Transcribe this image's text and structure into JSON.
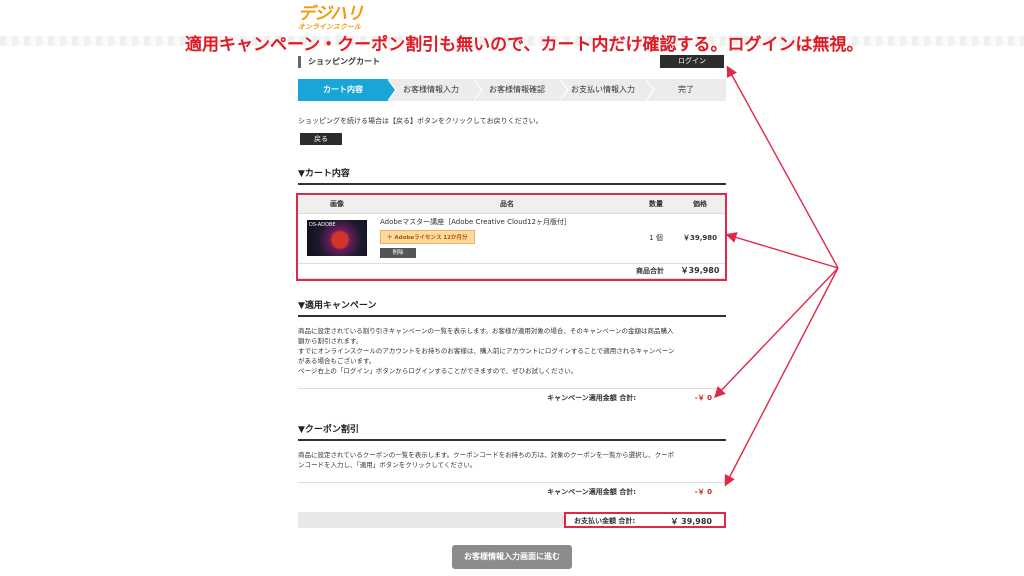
{
  "logo": {
    "line1": "デジハリ",
    "line2": "オンラインスクール"
  },
  "annotation": "適用キャンペーン・クーポン割引も無いので、カート内だけ確認する。ログインは無視。",
  "header": {
    "title": "ショッピングカート",
    "login_label": "ログイン"
  },
  "steps": [
    "カート内容",
    "お客様情報入力",
    "お客様情報確認",
    "お支払い情報入力",
    "完了"
  ],
  "intro": {
    "text": "ショッピングを続ける場合は【戻る】ボタンをクリックしてお戻りください。",
    "back_label": "戻る"
  },
  "cart": {
    "section_title": "▼カート内容",
    "headers": {
      "image": "画像",
      "name": "品名",
      "qty": "数量",
      "price": "価格"
    },
    "item": {
      "thumb_label": "DS-ADOBE",
      "name": "Adobeマスター講座［Adobe Creative Cloud12ヶ月版付］",
      "badge": "＋ Adobeライセンス 12か月分",
      "delete_label": "削除",
      "qty": "1 個",
      "price": "￥39,980"
    },
    "subtotal_label": "商品合計",
    "subtotal_value": "￥39,980"
  },
  "campaign": {
    "section_title": "▼適用キャンペーン",
    "description_lines": [
      "商品に設定されている割り引きキャンペーンの一覧を表示します。お客様が適用対象の場合、そのキャンペーンの金額は商品購入",
      "額から割引されます。",
      "すでにオンラインスクールのアカウントをお持ちのお客様は、購入前にアカウントにログインすることで適用されるキャンペーン",
      "がある場合もございます。",
      "ページ右上の「ログイン」ボタンからログインすることができますので、ぜひお試しください。"
    ],
    "sum_label": "キャンペーン適用金額 合計:",
    "sum_value": "-￥ 0"
  },
  "coupon": {
    "section_title": "▼クーポン割引",
    "description_lines": [
      "商品に設定されているクーポンの一覧を表示します。クーポンコードをお持ちの方は、対象のクーポンを一覧から選択し、クーポ",
      "ンコードを入力し、「適用」ボタンをクリックしてください。"
    ],
    "sum_label": "キャンペーン適用金額 合計:",
    "sum_value": "-￥ 0"
  },
  "total": {
    "label": "お支払い金額 合計:",
    "value": "￥ 39,980"
  },
  "next_label": "お客様情報入力画面に進む",
  "colors": {
    "accent": "#1aa5d9",
    "highlight": "#e0284a",
    "annotation": "#e01b24"
  }
}
